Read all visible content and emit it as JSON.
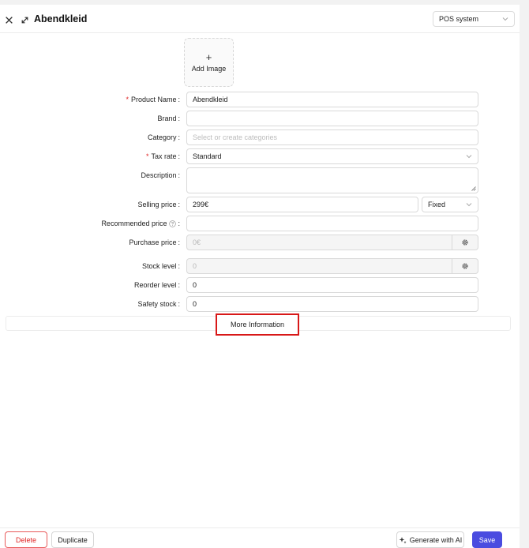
{
  "header": {
    "title": "Abendkleid",
    "channel_select": "POS system"
  },
  "image": {
    "add_label": "Add Image",
    "plus": "+"
  },
  "form": {
    "product_name": {
      "label": "Product Name",
      "value": "Abendkleid",
      "required": true
    },
    "brand": {
      "label": "Brand",
      "value": ""
    },
    "category": {
      "label": "Category",
      "placeholder": "Select or create categories"
    },
    "tax_rate": {
      "label": "Tax rate",
      "value": "Standard",
      "required": true
    },
    "description": {
      "label": "Description",
      "value": ""
    },
    "selling_price": {
      "label": "Selling price",
      "value": "299€",
      "mode": "Fixed"
    },
    "recommended_price": {
      "label": "Recommended price",
      "value": ""
    },
    "purchase_price": {
      "label": "Purchase price",
      "value": "0€"
    },
    "stock_level": {
      "label": "Stock level",
      "value": "0"
    },
    "reorder_level": {
      "label": "Reorder level",
      "value": "0"
    },
    "safety_stock": {
      "label": "Safety stock",
      "value": "0"
    },
    "required_mark": "*",
    "colon": ":"
  },
  "more_information": "More Information",
  "footer": {
    "delete": "Delete",
    "duplicate": "Duplicate",
    "generate_ai": "Generate with AI",
    "save": "Save"
  },
  "colors": {
    "accent": "#4a4ce0",
    "danger": "#e02424",
    "highlight_box": "#d81818"
  }
}
